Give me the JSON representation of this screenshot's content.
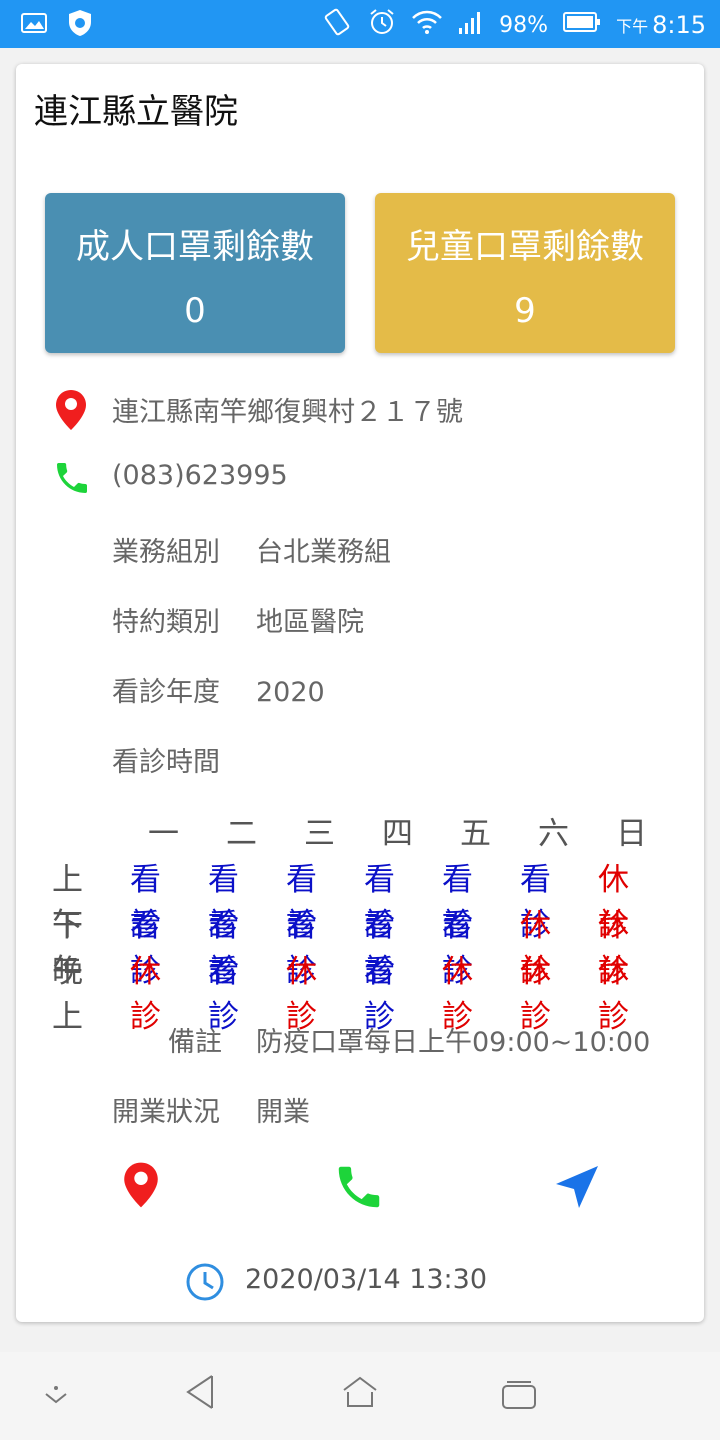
{
  "status_bar": {
    "battery": "98%",
    "time_prefix": "下午",
    "time": "8:15"
  },
  "card": {
    "title": "連江縣立醫院",
    "adult_mask": {
      "label": "成人口罩剩餘數",
      "value": "0"
    },
    "child_mask": {
      "label": "兒童口罩剩餘數",
      "value": "9"
    },
    "address": "連江縣南竿鄉復興村２１７號",
    "phone": "(083)623995",
    "business_group": {
      "label": "業務組別",
      "value": "台北業務組"
    },
    "contract_type": {
      "label": "特約類別",
      "value": "地區醫院"
    },
    "year": {
      "label": "看診年度",
      "value": "2020"
    },
    "hours_label": "看診時間",
    "schedule": {
      "days": [
        "一",
        "二",
        "三",
        "四",
        "五",
        "六",
        "日"
      ],
      "rows": [
        {
          "label": "上午",
          "cells": [
            "看診",
            "看診",
            "看診",
            "看診",
            "看診",
            "看診",
            "休診"
          ]
        },
        {
          "label": "下午",
          "cells": [
            "看診",
            "看診",
            "看診",
            "看診",
            "看診",
            "休診",
            "休診"
          ]
        },
        {
          "label": "晚上",
          "cells": [
            "休診",
            "看診",
            "休診",
            "看診",
            "休診",
            "休診",
            "休診"
          ]
        }
      ]
    },
    "note": {
      "label": "備註",
      "value": "防疫口罩每日上午09:00~10:00"
    },
    "open_status": {
      "label": "開業狀況",
      "value": "開業"
    },
    "updated": "2020/03/14 13:30"
  },
  "colors": {
    "open": "#0b10c8",
    "closed": "#e00000",
    "adult_tile": "#4a8fb2",
    "child_tile": "#e4bb48",
    "status_bar": "#2196f3"
  },
  "icons": [
    "image-icon",
    "shield-app-icon",
    "vibrate-icon",
    "alarm-icon",
    "wifi-icon",
    "signal-icon",
    "battery-icon",
    "location-pin-icon",
    "phone-icon",
    "navigate-icon",
    "clock-icon"
  ]
}
